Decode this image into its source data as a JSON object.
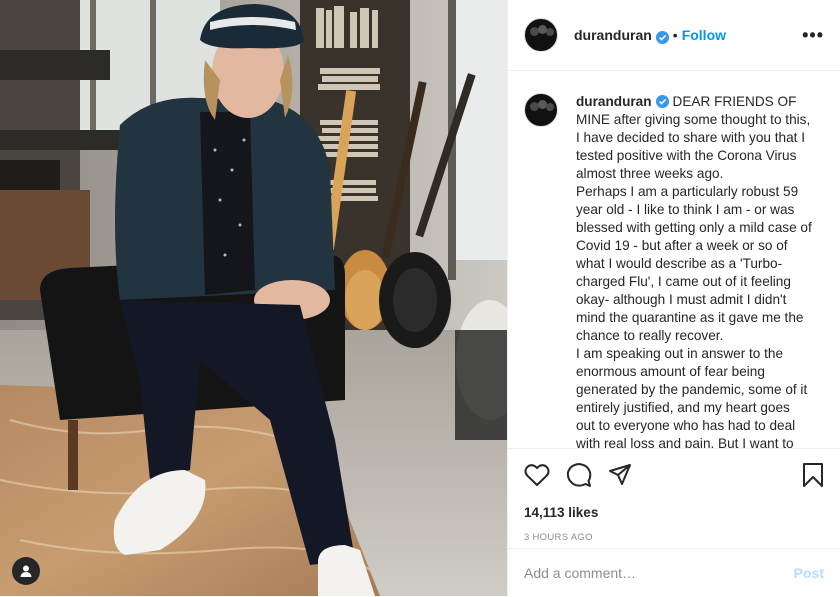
{
  "post": {
    "username": "duranduran",
    "verified": true,
    "follow_label": "Follow",
    "dot": "•",
    "more_label": "•••",
    "caption_paragraphs": [
      "DEAR FRIENDS OF MINE after giving some thought to this, I have decided to share with you that I tested positive with the Corona Virus almost three weeks ago.",
      "Perhaps I am a particularly robust 59 year old - I like to think I am - or was blessed with getting only a mild case of Covid 19 - but after a week or so of what I would describe as a 'Turbo-charged Flu', I came out of it feeling okay- although I must admit I didn't mind the quarantine as it gave me the chance to really recover.",
      "I am speaking out in answer to the enormous amount of fear being generated by the pandemic, some of it entirely justified, and my heart goes out to everyone who has had to deal with real loss and pain. But I want to"
    ],
    "likes": "14,113 likes",
    "time": "3 HOURS AGO",
    "comment_placeholder": "Add a comment…",
    "post_label": "Post"
  },
  "icons": {
    "like": "heart-icon",
    "comment": "comment-icon",
    "share": "share-icon",
    "save": "bookmark-icon",
    "user_tag": "user-tag-icon"
  },
  "colors": {
    "accent": "#0095f6",
    "verified": "#3897f0",
    "muted": "#8e8e8e",
    "post_disabled": "#b2dffc"
  }
}
